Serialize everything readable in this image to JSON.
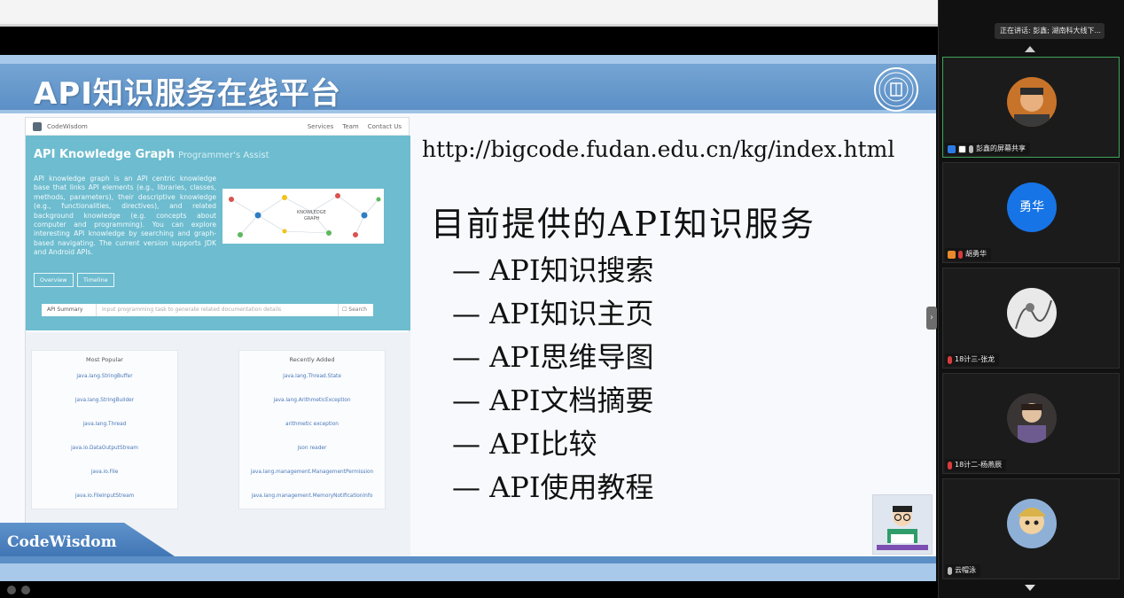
{
  "slide": {
    "title": "API知识服务在线平台",
    "url": "http://bigcode.fudan.edu.cn/kg/index.html",
    "heading": "目前提供的API知识服务",
    "services": [
      "— API知识搜索",
      "— API知识主页",
      "— API思维导图",
      "— API文档摘要",
      "— API比较",
      "— API使用教程"
    ],
    "footer_brand": "CodeWisdom"
  },
  "website": {
    "brand": "CodeWisdom",
    "nav": [
      "Services",
      "Team",
      "Contact Us"
    ],
    "hero_title": "API Knowledge Graph",
    "hero_subtitle": "Programmer's Assist",
    "description": "API knowledge graph is an API centric knowledge base that links API elements (e.g., libraries, classes, methods, parameters), their descriptive knowledge (e.g., functionalities, directives), and related background knowledge (e.g. concepts about computer and programming). You can explore interesting API knowledge by searching and graph-based navigating. The current version supports JDK and Android APIs.",
    "graph_label": "KNOWLEDGE GRAPH",
    "buttons": [
      "Overview",
      "Timeline"
    ],
    "search": {
      "select": "API Summary",
      "placeholder": "Input programming task to generate related documentation details",
      "button": "☐ Search"
    },
    "most_popular": {
      "title": "Most Popular",
      "items": [
        "java.lang.StringBuffer",
        "java.lang.StringBuilder",
        "java.lang.Thread",
        "java.io.DataOutputStream",
        "java.io.File",
        "java.io.FileInputStream"
      ]
    },
    "recently_added": {
      "title": "Recently Added",
      "items": [
        "java.lang.Thread.State",
        "java.lang.ArithmeticException",
        "arithmetic exception",
        "json reader",
        "java.lang.management.ManagementPermission",
        "java.lang.management.MemoryNotificationInfo"
      ]
    }
  },
  "meeting": {
    "speaking_now": "正在讲话: 彭鑫; 湖南科大线下...",
    "participants": [
      {
        "name": "彭鑫的屏幕共享",
        "avatar_type": "photo",
        "active": true
      },
      {
        "name": "胡勇华",
        "avatar_type": "text",
        "avatar_text": "勇华"
      },
      {
        "name": "18计三-张龙",
        "avatar_type": "photo"
      },
      {
        "name": "18计二-杨燕辰",
        "avatar_type": "photo"
      },
      {
        "name": "云帽泳",
        "avatar_type": "photo"
      }
    ]
  },
  "colors": {
    "header_blue": "#5b8fc6",
    "hero_teal": "#6dbccf",
    "active_border": "#3fa55c",
    "avatar_blue": "#1774e6"
  }
}
